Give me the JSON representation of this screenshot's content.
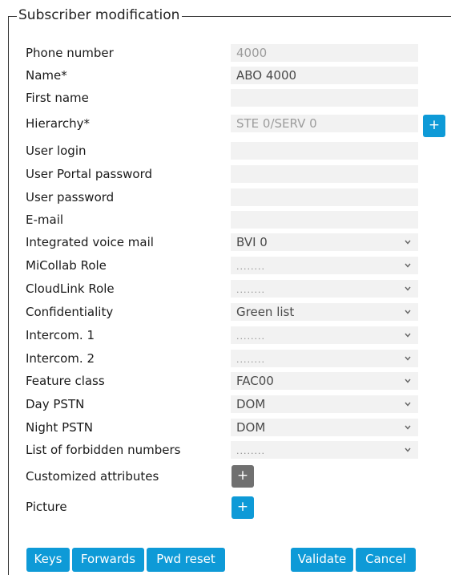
{
  "form": {
    "title": "Subscriber modification",
    "fields": {
      "phone": {
        "label": "Phone number",
        "value": "4000"
      },
      "name": {
        "label": "Name*",
        "value": "ABO 4000"
      },
      "first_name": {
        "label": "First name",
        "value": ""
      },
      "hierarchy": {
        "label": "Hierarchy*",
        "value": "STE 0/SERV 0",
        "button": "+"
      },
      "user_login": {
        "label": "User login",
        "value": ""
      },
      "portal_password": {
        "label": "User Portal password",
        "value": ""
      },
      "user_password": {
        "label": "User password",
        "value": ""
      },
      "email": {
        "label": "E-mail",
        "value": ""
      },
      "voice_mail": {
        "label": "Integrated voice mail",
        "value": "BVI 0"
      },
      "micollab_role": {
        "label": "MiCollab Role",
        "value": "........"
      },
      "cloudlink_role": {
        "label": "CloudLink Role",
        "value": "........"
      },
      "confidentiality": {
        "label": "Confidentiality",
        "value": "Green list"
      },
      "intercom1": {
        "label": "Intercom. 1",
        "value": "........"
      },
      "intercom2": {
        "label": "Intercom. 2",
        "value": "........"
      },
      "feature_class": {
        "label": "Feature class",
        "value": "FAC00"
      },
      "day_pstn": {
        "label": "Day PSTN",
        "value": "DOM"
      },
      "night_pstn": {
        "label": "Night PSTN",
        "value": "DOM"
      },
      "forbidden_numbers": {
        "label": "List of forbidden numbers",
        "value": "........"
      },
      "custom_attributes": {
        "label": "Customized attributes",
        "button": "+"
      },
      "picture": {
        "label": "Picture",
        "button": "+"
      }
    }
  },
  "actions": {
    "keys": "Keys",
    "forwards": "Forwards",
    "pwd_reset": "Pwd reset",
    "validate": "Validate",
    "cancel": "Cancel"
  },
  "colors": {
    "accent": "#0e9ad7",
    "field_bg": "#f2f2f2",
    "disabled_button": "#707070"
  },
  "icons": {
    "dropdown": "chevron-down-icon",
    "add": "plus-icon"
  }
}
